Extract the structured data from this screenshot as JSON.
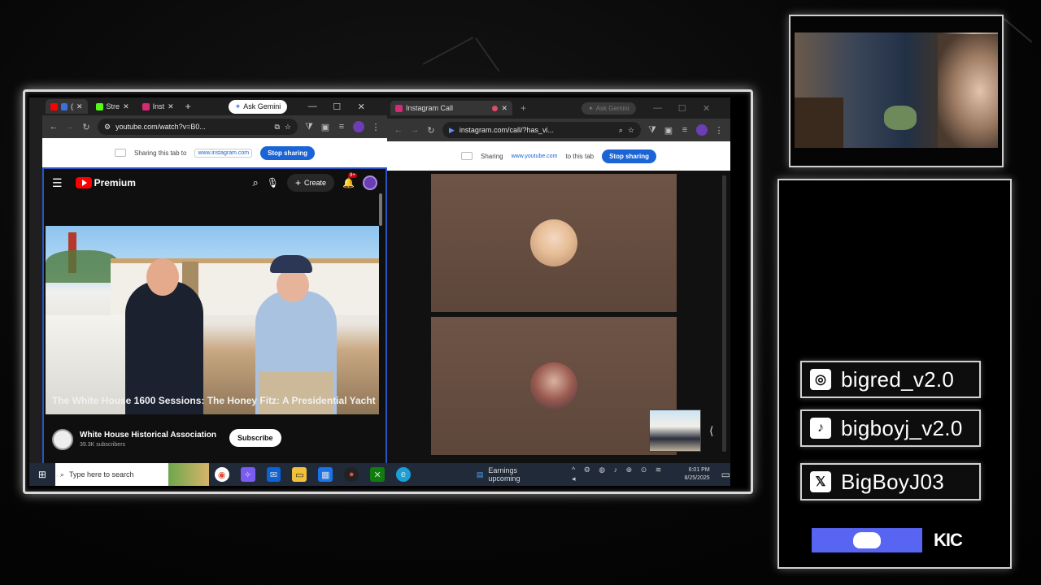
{
  "left_browser": {
    "tabs": [
      {
        "label": "(",
        "color": "#ff0000"
      },
      {
        "label": "Stre",
        "color": "#53fc18"
      },
      {
        "label": "Inst",
        "color": "#d62976"
      }
    ],
    "new_tab": "+",
    "ask_gemini": "Ask Gemini",
    "url": "youtube.com/watch?v=B0...",
    "share_text": "Sharing this tab to",
    "share_site": "www.instagram.com",
    "stop_sharing": "Stop sharing"
  },
  "youtube": {
    "logo_text": "Premium",
    "create_label": "Create",
    "notif_count": "9+",
    "video_title": "The White House 1600 Sessions: The Honey Fitz: A Presidential Yacht",
    "channel_name": "White House Historical Association",
    "subscribers": "39.3K subscribers",
    "subscribe_label": "Subscribe"
  },
  "right_browser": {
    "tab_title": "Instagram Call",
    "new_tab": "+",
    "ask_gemini": "Ask Gemini",
    "url": "instagram.com/call/?has_vi...",
    "share_prefix": "Sharing",
    "share_site": "www.youtube.com",
    "share_suffix": "to this tab",
    "stop_sharing": "Stop sharing"
  },
  "taskbar": {
    "search_placeholder": "Type here to search",
    "news_text": "Earnings upcoming",
    "time": "6:01 PM",
    "date": "8/25/2025"
  },
  "socials": {
    "instagram": "bigred_v2.0",
    "tiktok": "bigboyj_v2.0",
    "x": "BigBoyJ03",
    "kick": "KIC"
  },
  "colors": {
    "youtube_red": "#ff0000",
    "share_blue": "#1a64d6",
    "discord": "#5865f2",
    "taskbar": "#202a38"
  }
}
